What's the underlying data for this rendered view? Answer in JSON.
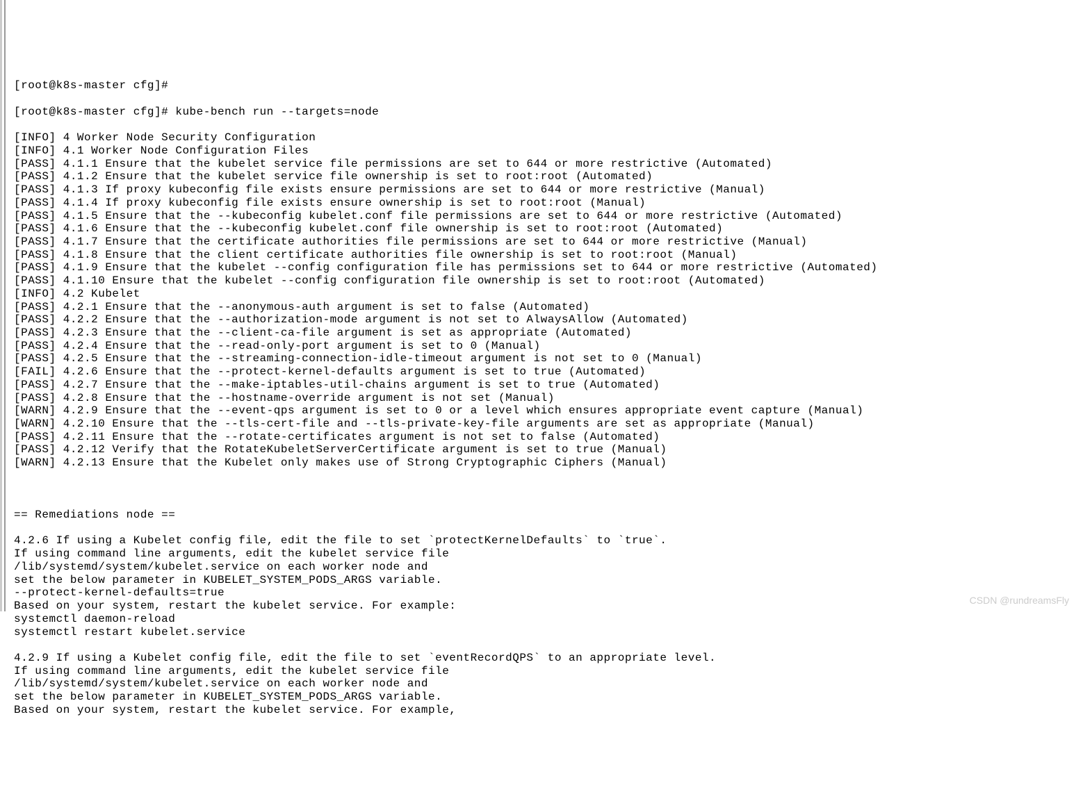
{
  "terminal": {
    "prompts": [
      "[root@k8s-master cfg]#",
      "[root@k8s-master cfg]# kube-bench run --targets=node"
    ],
    "checks": [
      {
        "status": "INFO",
        "id": "4",
        "text": "Worker Node Security Configuration"
      },
      {
        "status": "INFO",
        "id": "4.1",
        "text": "Worker Node Configuration Files"
      },
      {
        "status": "PASS",
        "id": "4.1.1",
        "text": "Ensure that the kubelet service file permissions are set to 644 or more restrictive (Automated)"
      },
      {
        "status": "PASS",
        "id": "4.1.2",
        "text": "Ensure that the kubelet service file ownership is set to root:root (Automated)"
      },
      {
        "status": "PASS",
        "id": "4.1.3",
        "text": "If proxy kubeconfig file exists ensure permissions are set to 644 or more restrictive (Manual)"
      },
      {
        "status": "PASS",
        "id": "4.1.4",
        "text": "If proxy kubeconfig file exists ensure ownership is set to root:root (Manual)"
      },
      {
        "status": "PASS",
        "id": "4.1.5",
        "text": "Ensure that the --kubeconfig kubelet.conf file permissions are set to 644 or more restrictive (Automated)"
      },
      {
        "status": "PASS",
        "id": "4.1.6",
        "text": "Ensure that the --kubeconfig kubelet.conf file ownership is set to root:root (Automated)"
      },
      {
        "status": "PASS",
        "id": "4.1.7",
        "text": "Ensure that the certificate authorities file permissions are set to 644 or more restrictive (Manual)"
      },
      {
        "status": "PASS",
        "id": "4.1.8",
        "text": "Ensure that the client certificate authorities file ownership is set to root:root (Manual)"
      },
      {
        "status": "PASS",
        "id": "4.1.9",
        "text": "Ensure that the kubelet --config configuration file has permissions set to 644 or more restrictive (Automated)"
      },
      {
        "status": "PASS",
        "id": "4.1.10",
        "text": "Ensure that the kubelet --config configuration file ownership is set to root:root (Automated)"
      },
      {
        "status": "INFO",
        "id": "4.2",
        "text": "Kubelet"
      },
      {
        "status": "PASS",
        "id": "4.2.1",
        "text": "Ensure that the --anonymous-auth argument is set to false (Automated)"
      },
      {
        "status": "PASS",
        "id": "4.2.2",
        "text": "Ensure that the --authorization-mode argument is not set to AlwaysAllow (Automated)"
      },
      {
        "status": "PASS",
        "id": "4.2.3",
        "text": "Ensure that the --client-ca-file argument is set as appropriate (Automated)"
      },
      {
        "status": "PASS",
        "id": "4.2.4",
        "text": "Ensure that the --read-only-port argument is set to 0 (Manual)"
      },
      {
        "status": "PASS",
        "id": "4.2.5",
        "text": "Ensure that the --streaming-connection-idle-timeout argument is not set to 0 (Manual)"
      },
      {
        "status": "FAIL",
        "id": "4.2.6",
        "text": "Ensure that the --protect-kernel-defaults argument is set to true (Automated)"
      },
      {
        "status": "PASS",
        "id": "4.2.7",
        "text": "Ensure that the --make-iptables-util-chains argument is set to true (Automated)"
      },
      {
        "status": "PASS",
        "id": "4.2.8",
        "text": "Ensure that the --hostname-override argument is not set (Manual)"
      },
      {
        "status": "WARN",
        "id": "4.2.9",
        "text": "Ensure that the --event-qps argument is set to 0 or a level which ensures appropriate event capture (Manual)"
      },
      {
        "status": "WARN",
        "id": "4.2.10",
        "text": "Ensure that the --tls-cert-file and --tls-private-key-file arguments are set as appropriate (Manual)"
      },
      {
        "status": "PASS",
        "id": "4.2.11",
        "text": "Ensure that the --rotate-certificates argument is not set to false (Automated)"
      },
      {
        "status": "PASS",
        "id": "4.2.12",
        "text": "Verify that the RotateKubeletServerCertificate argument is set to true (Manual)"
      },
      {
        "status": "WARN",
        "id": "4.2.13",
        "text": "Ensure that the Kubelet only makes use of Strong Cryptographic Ciphers (Manual)"
      }
    ],
    "remediations_header": "== Remediations node ==",
    "remediations": [
      "4.2.6 If using a Kubelet config file, edit the file to set `protectKernelDefaults` to `true`.",
      "If using command line arguments, edit the kubelet service file",
      "/lib/systemd/system/kubelet.service on each worker node and",
      "set the below parameter in KUBELET_SYSTEM_PODS_ARGS variable.",
      "--protect-kernel-defaults=true",
      "Based on your system, restart the kubelet service. For example:",
      "systemctl daemon-reload",
      "systemctl restart kubelet.service",
      "",
      "4.2.9 If using a Kubelet config file, edit the file to set `eventRecordQPS` to an appropriate level.",
      "If using command line arguments, edit the kubelet service file",
      "/lib/systemd/system/kubelet.service on each worker node and",
      "set the below parameter in KUBELET_SYSTEM_PODS_ARGS variable.",
      "Based on your system, restart the kubelet service. For example,"
    ]
  },
  "watermark": "CSDN @rundreamsFly"
}
